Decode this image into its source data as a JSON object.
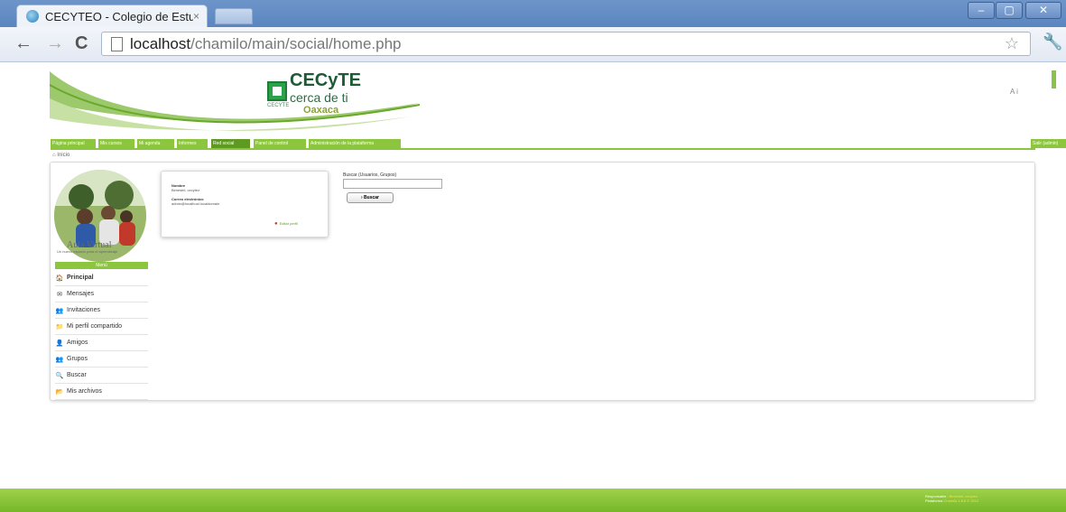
{
  "browser": {
    "tab_title": "CECYTEO - Colegio de Estu",
    "tab_close": "×",
    "url_host": "localhost",
    "url_path": "/chamilo/main/social/home.php",
    "star": "☆",
    "wrench": "🔧",
    "back": "←",
    "forward": "→",
    "reload": "C",
    "min": "–",
    "max": "▢",
    "close": "✕"
  },
  "header": {
    "logo_title": "CECyTE",
    "logo_sub": "cerca de ti",
    "logo_place": "Oaxaca",
    "logo_small": "CECYTE",
    "user_abbr": "A i",
    "accent": "#8cc63f"
  },
  "nav": {
    "tabs": [
      "Página principal",
      "Mis cursos",
      "Mi agenda",
      "Informes",
      "Red social",
      "Panel de control",
      "Administración de la plataforma"
    ],
    "active_index": 4,
    "logout": "Salir (admin)"
  },
  "breadcrumb": "Inicio",
  "sidebar": {
    "avatar_caption": "Aula Virtual",
    "avatar_tagline": "Un nuevo espacio para el aprendizaje",
    "menu_title": "Menú",
    "items": [
      {
        "label": "Principal",
        "icon": "🏠"
      },
      {
        "label": "Mensajes",
        "icon": "✉"
      },
      {
        "label": "Invitaciones",
        "icon": "👥"
      },
      {
        "label": "Mi perfil compartido",
        "icon": "📁"
      },
      {
        "label": "Amigos",
        "icon": "👤"
      },
      {
        "label": "Grupos",
        "icon": "👥"
      },
      {
        "label": "Buscar",
        "icon": "🔍"
      },
      {
        "label": "Mis archivos",
        "icon": "📂"
      }
    ]
  },
  "profile": {
    "name_label": "Nombre",
    "name_value": "Bimestril, cecytez",
    "email_label": "Correo electrónico",
    "email_value": "admin@localhost.localdomain",
    "edit_label": "Editar perfil"
  },
  "search": {
    "label": "Buscar (Usuarios, Grupos)",
    "value": "",
    "button": "Buscar"
  },
  "footer": {
    "line1_label": "Responsable :",
    "line1_value": "Bimestril, cecytez",
    "line2_label": "Plataforma",
    "line2_value": "Chamilo 1.8.8 © 2012"
  }
}
